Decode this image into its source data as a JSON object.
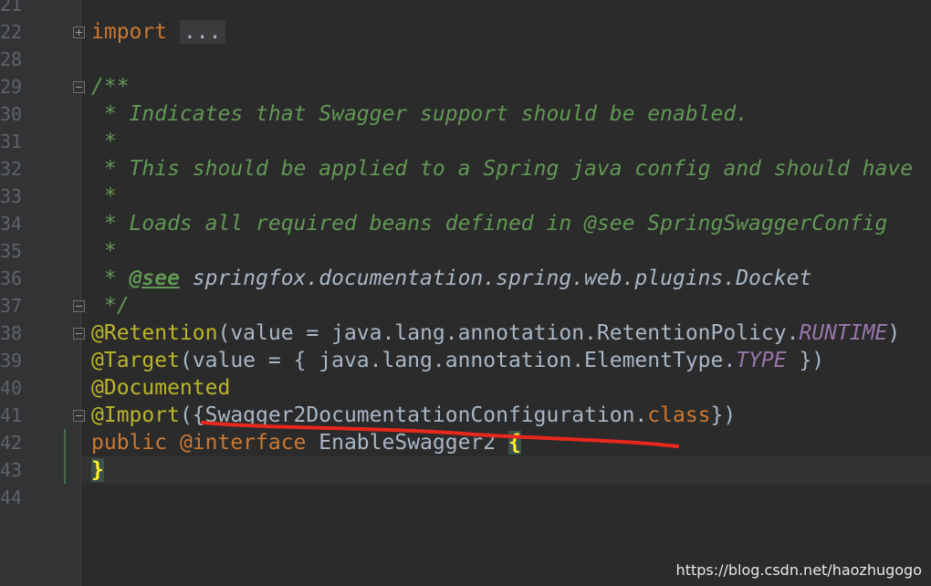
{
  "gutter": {
    "line_numbers": [
      "21",
      "22",
      "28",
      "29",
      "30",
      "31",
      "32",
      "33",
      "34",
      "35",
      "36",
      "37",
      "38",
      "39",
      "40",
      "41",
      "42",
      "43",
      "44"
    ]
  },
  "code": {
    "l22_kw": "import",
    "l22_folded": "...",
    "l29": "/**",
    "l30": " * Indicates that Swagger support should be enabled.",
    "l31": " *",
    "l32": " * This should be applied to a Spring java config and should have",
    "l33": " *",
    "l34": " * Loads all required beans defined in @see SpringSwaggerConfig",
    "l35": " *",
    "l36_star": " * ",
    "l36_tag": "@see",
    "l36_ref": " springfox.documentation.spring.web.plugins.Docket",
    "l37": " */",
    "l38_ann": "@Retention",
    "l38_mid": "(value = java.lang.annotation.RetentionPolicy.",
    "l38_const": "RUNTIME",
    "l38_end": ")",
    "l39_ann": "@Target",
    "l39_mid": "(value = { java.lang.annotation.ElementType.",
    "l39_const": "TYPE",
    "l39_end": " })",
    "l40_ann": "@Documented",
    "l41_ann": "@Import",
    "l41_mid": "({Swagger2DocumentationConfiguration.",
    "l41_kw": "class",
    "l41_end": "})",
    "l42_kw1": "public ",
    "l42_kw2": "@interface",
    "l42_name": " EnableSwagger2 ",
    "l42_brace": "{",
    "l43_brace": "}"
  },
  "annotation": {
    "underline_color": "#e8281c"
  },
  "watermark": "https://blog.csdn.net/haozhugogo"
}
